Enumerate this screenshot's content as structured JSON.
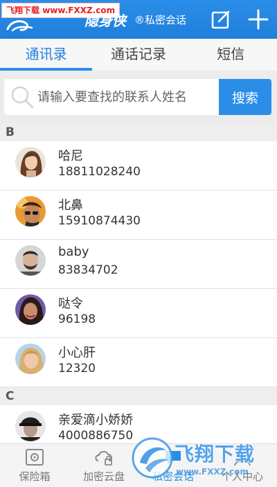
{
  "watermark_top": {
    "prefix": "飞翔下载",
    "url": "www.FXXZ.com"
  },
  "header": {
    "app_name": "隐身侠",
    "subtitle": "®私密会话",
    "compose_icon": "compose-icon",
    "add_icon": "plus-icon"
  },
  "tabs": [
    {
      "label": "通讯录",
      "active": true
    },
    {
      "label": "通话记录",
      "active": false
    },
    {
      "label": "短信",
      "active": false
    }
  ],
  "search": {
    "placeholder": "请输入要查找的联系人姓名",
    "value": "",
    "button_label": "搜索"
  },
  "sections": [
    {
      "letter": "B",
      "contacts": [
        {
          "name": "哈尼",
          "phone": "18811028240",
          "avatar": "avatar-woman-brown-hair"
        },
        {
          "name": "北鼻",
          "phone": "15910874430",
          "avatar": "avatar-man-sunglasses"
        },
        {
          "name": "baby",
          "phone": "83834702",
          "avatar": "avatar-man-beard"
        },
        {
          "name": "哒令",
          "phone": "96198",
          "avatar": "avatar-woman-dark-hair"
        },
        {
          "name": "小心肝",
          "phone": "12320",
          "avatar": "avatar-woman-blonde"
        }
      ]
    },
    {
      "letter": "C",
      "contacts": [
        {
          "name": "亲爱滴小娇娇",
          "phone": "4000886750",
          "avatar": "avatar-man-cap"
        }
      ]
    }
  ],
  "bottom_nav": [
    {
      "label": "保险箱",
      "icon": "safe-icon",
      "active": false
    },
    {
      "label": "加密云盘",
      "icon": "cloud-lock-icon",
      "active": false
    },
    {
      "label": "私密会话",
      "icon": "chat-icon",
      "active": true
    },
    {
      "label": "个人中心",
      "icon": "user-icon",
      "active": false
    }
  ],
  "watermark_bottom": {
    "text": "飞翔下载",
    "url": "www.FXXZ.com"
  },
  "colors": {
    "primary": "#2a8ee8",
    "tab_active": "#1f7fdc",
    "section_bg": "#eeeeee"
  }
}
